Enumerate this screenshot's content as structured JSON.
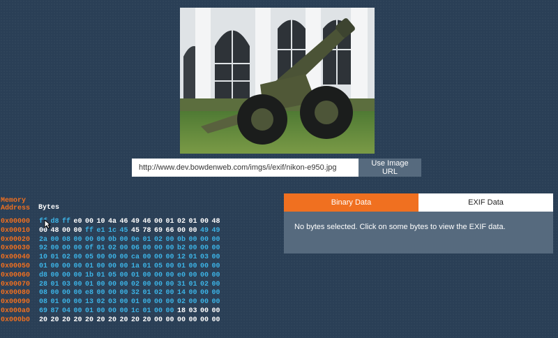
{
  "url_input": {
    "value": "http://www.dev.bowdenweb.com/imgs/i/exif/nikon-e950.jpg",
    "button_label": "Use Image URL"
  },
  "hex_view": {
    "address_header": "Memory Address",
    "bytes_header": "Bytes",
    "rows": [
      {
        "addr": "0x00000",
        "bytes": [
          "ff",
          "d8",
          "ff",
          "e0",
          "00",
          "10",
          "4a",
          "46",
          "49",
          "46",
          "00",
          "01",
          "02",
          "01",
          "00",
          "48"
        ],
        "hl": [
          1,
          1,
          1,
          0,
          0,
          0,
          0,
          0,
          0,
          0,
          0,
          0,
          0,
          0,
          0,
          0
        ]
      },
      {
        "addr": "0x00010",
        "bytes": [
          "00",
          "48",
          "00",
          "00",
          "ff",
          "e1",
          "1c",
          "45",
          "45",
          "78",
          "69",
          "66",
          "00",
          "00",
          "49",
          "49"
        ],
        "hl": [
          0,
          0,
          0,
          0,
          1,
          1,
          1,
          1,
          0,
          0,
          0,
          0,
          0,
          0,
          1,
          1
        ]
      },
      {
        "addr": "0x00020",
        "bytes": [
          "2a",
          "00",
          "08",
          "00",
          "00",
          "00",
          "0b",
          "00",
          "0e",
          "01",
          "02",
          "00",
          "0b",
          "00",
          "00",
          "00"
        ],
        "hl": [
          1,
          1,
          1,
          1,
          1,
          1,
          1,
          1,
          1,
          1,
          1,
          1,
          1,
          1,
          1,
          1
        ]
      },
      {
        "addr": "0x00030",
        "bytes": [
          "92",
          "00",
          "00",
          "00",
          "0f",
          "01",
          "02",
          "00",
          "06",
          "00",
          "00",
          "00",
          "b2",
          "00",
          "00",
          "00"
        ],
        "hl": [
          1,
          1,
          1,
          1,
          1,
          1,
          1,
          1,
          1,
          1,
          1,
          1,
          1,
          1,
          1,
          1
        ]
      },
      {
        "addr": "0x00040",
        "bytes": [
          "10",
          "01",
          "02",
          "00",
          "05",
          "00",
          "00",
          "00",
          "ca",
          "00",
          "00",
          "00",
          "12",
          "01",
          "03",
          "00"
        ],
        "hl": [
          1,
          1,
          1,
          1,
          1,
          1,
          1,
          1,
          1,
          1,
          1,
          1,
          1,
          1,
          1,
          1
        ]
      },
      {
        "addr": "0x00050",
        "bytes": [
          "01",
          "00",
          "00",
          "00",
          "01",
          "00",
          "00",
          "00",
          "1a",
          "01",
          "05",
          "00",
          "01",
          "00",
          "00",
          "00"
        ],
        "hl": [
          1,
          1,
          1,
          1,
          1,
          1,
          1,
          1,
          1,
          1,
          1,
          1,
          1,
          1,
          1,
          1
        ]
      },
      {
        "addr": "0x00060",
        "bytes": [
          "d8",
          "00",
          "00",
          "00",
          "1b",
          "01",
          "05",
          "00",
          "01",
          "00",
          "00",
          "00",
          "e0",
          "00",
          "00",
          "00"
        ],
        "hl": [
          1,
          1,
          1,
          1,
          1,
          1,
          1,
          1,
          1,
          1,
          1,
          1,
          1,
          1,
          1,
          1
        ]
      },
      {
        "addr": "0x00070",
        "bytes": [
          "28",
          "01",
          "03",
          "00",
          "01",
          "00",
          "00",
          "00",
          "02",
          "00",
          "00",
          "00",
          "31",
          "01",
          "02",
          "00"
        ],
        "hl": [
          1,
          1,
          1,
          1,
          1,
          1,
          1,
          1,
          1,
          1,
          1,
          1,
          1,
          1,
          1,
          1
        ]
      },
      {
        "addr": "0x00080",
        "bytes": [
          "08",
          "00",
          "00",
          "00",
          "e8",
          "00",
          "00",
          "00",
          "32",
          "01",
          "02",
          "00",
          "14",
          "00",
          "00",
          "00"
        ],
        "hl": [
          1,
          1,
          1,
          1,
          1,
          1,
          1,
          1,
          1,
          1,
          1,
          1,
          1,
          1,
          1,
          1
        ]
      },
      {
        "addr": "0x00090",
        "bytes": [
          "08",
          "01",
          "00",
          "00",
          "13",
          "02",
          "03",
          "00",
          "01",
          "00",
          "00",
          "00",
          "02",
          "00",
          "00",
          "00"
        ],
        "hl": [
          1,
          1,
          1,
          1,
          1,
          1,
          1,
          1,
          1,
          1,
          1,
          1,
          1,
          1,
          1,
          1
        ]
      },
      {
        "addr": "0x000a0",
        "bytes": [
          "69",
          "87",
          "04",
          "00",
          "01",
          "00",
          "00",
          "00",
          "1c",
          "01",
          "00",
          "00",
          "18",
          "03",
          "00",
          "00"
        ],
        "hl": [
          1,
          1,
          1,
          1,
          1,
          1,
          1,
          1,
          1,
          1,
          1,
          1,
          0,
          0,
          0,
          0
        ]
      },
      {
        "addr": "0x000b0",
        "bytes": [
          "20",
          "20",
          "20",
          "20",
          "20",
          "20",
          "20",
          "20",
          "20",
          "20",
          "00",
          "00",
          "00",
          "00",
          "00",
          "00"
        ],
        "hl": [
          0,
          0,
          0,
          0,
          0,
          0,
          0,
          0,
          0,
          0,
          0,
          0,
          0,
          0,
          0,
          0
        ]
      }
    ]
  },
  "tabs": [
    {
      "label": "Binary Data",
      "active": true
    },
    {
      "label": "EXIF Data",
      "active": false
    }
  ],
  "panel": {
    "message": "No bytes selected. Click on some bytes to view the EXIF data."
  },
  "colors": {
    "background": "#2a3f56",
    "accent": "#f07020",
    "highlight_byte": "#3cb3e6",
    "plain_byte": "#ffffff",
    "panel": "#566a7e"
  },
  "icons": {
    "cursor": "mouse-pointer-icon"
  }
}
